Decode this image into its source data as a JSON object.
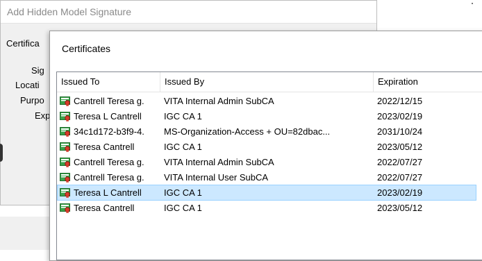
{
  "background_dialog": {
    "title": "Add Hidden Model Signature",
    "labels": [
      "Certifica",
      "Sig",
      "Locati",
      "Purpo",
      "Exp"
    ]
  },
  "certificates_dialog": {
    "title": "Certificates",
    "columns": [
      "Issued To",
      "Issued By",
      "Expiration"
    ],
    "rows": [
      {
        "issued_to": "Cantrell Teresa g.",
        "issued_by": "VITA Internal Admin SubCA",
        "expiration": "2022/12/15",
        "selected": false
      },
      {
        "issued_to": "Teresa L Cantrell",
        "issued_by": "IGC CA 1",
        "expiration": "2023/02/19",
        "selected": false
      },
      {
        "issued_to": "34c1d172-b3f9-4.",
        "issued_by": "MS-Organization-Access + OU=82dbac...",
        "expiration": "2031/10/24",
        "selected": false
      },
      {
        "issued_to": "Teresa Cantrell",
        "issued_by": "IGC CA 1",
        "expiration": "2023/05/12",
        "selected": false
      },
      {
        "issued_to": "Cantrell Teresa g.",
        "issued_by": "VITA Internal Admin SubCA",
        "expiration": "2022/07/27",
        "selected": false
      },
      {
        "issued_to": "Cantrell Teresa g.",
        "issued_by": "VITA Internal User SubCA",
        "expiration": "2022/07/27",
        "selected": false
      },
      {
        "issued_to": "Teresa L Cantrell",
        "issued_by": "IGC CA 1",
        "expiration": "2023/02/19",
        "selected": true
      },
      {
        "issued_to": "Teresa Cantrell",
        "issued_by": "IGC CA 1",
        "expiration": "2023/05/12",
        "selected": false
      }
    ],
    "row_icon": "certificate-icon"
  },
  "colors": {
    "selection_bg": "#cce8ff",
    "selection_border": "#99d1ff",
    "icon_green": "#3aa14a",
    "icon_red": "#d83b2b"
  }
}
